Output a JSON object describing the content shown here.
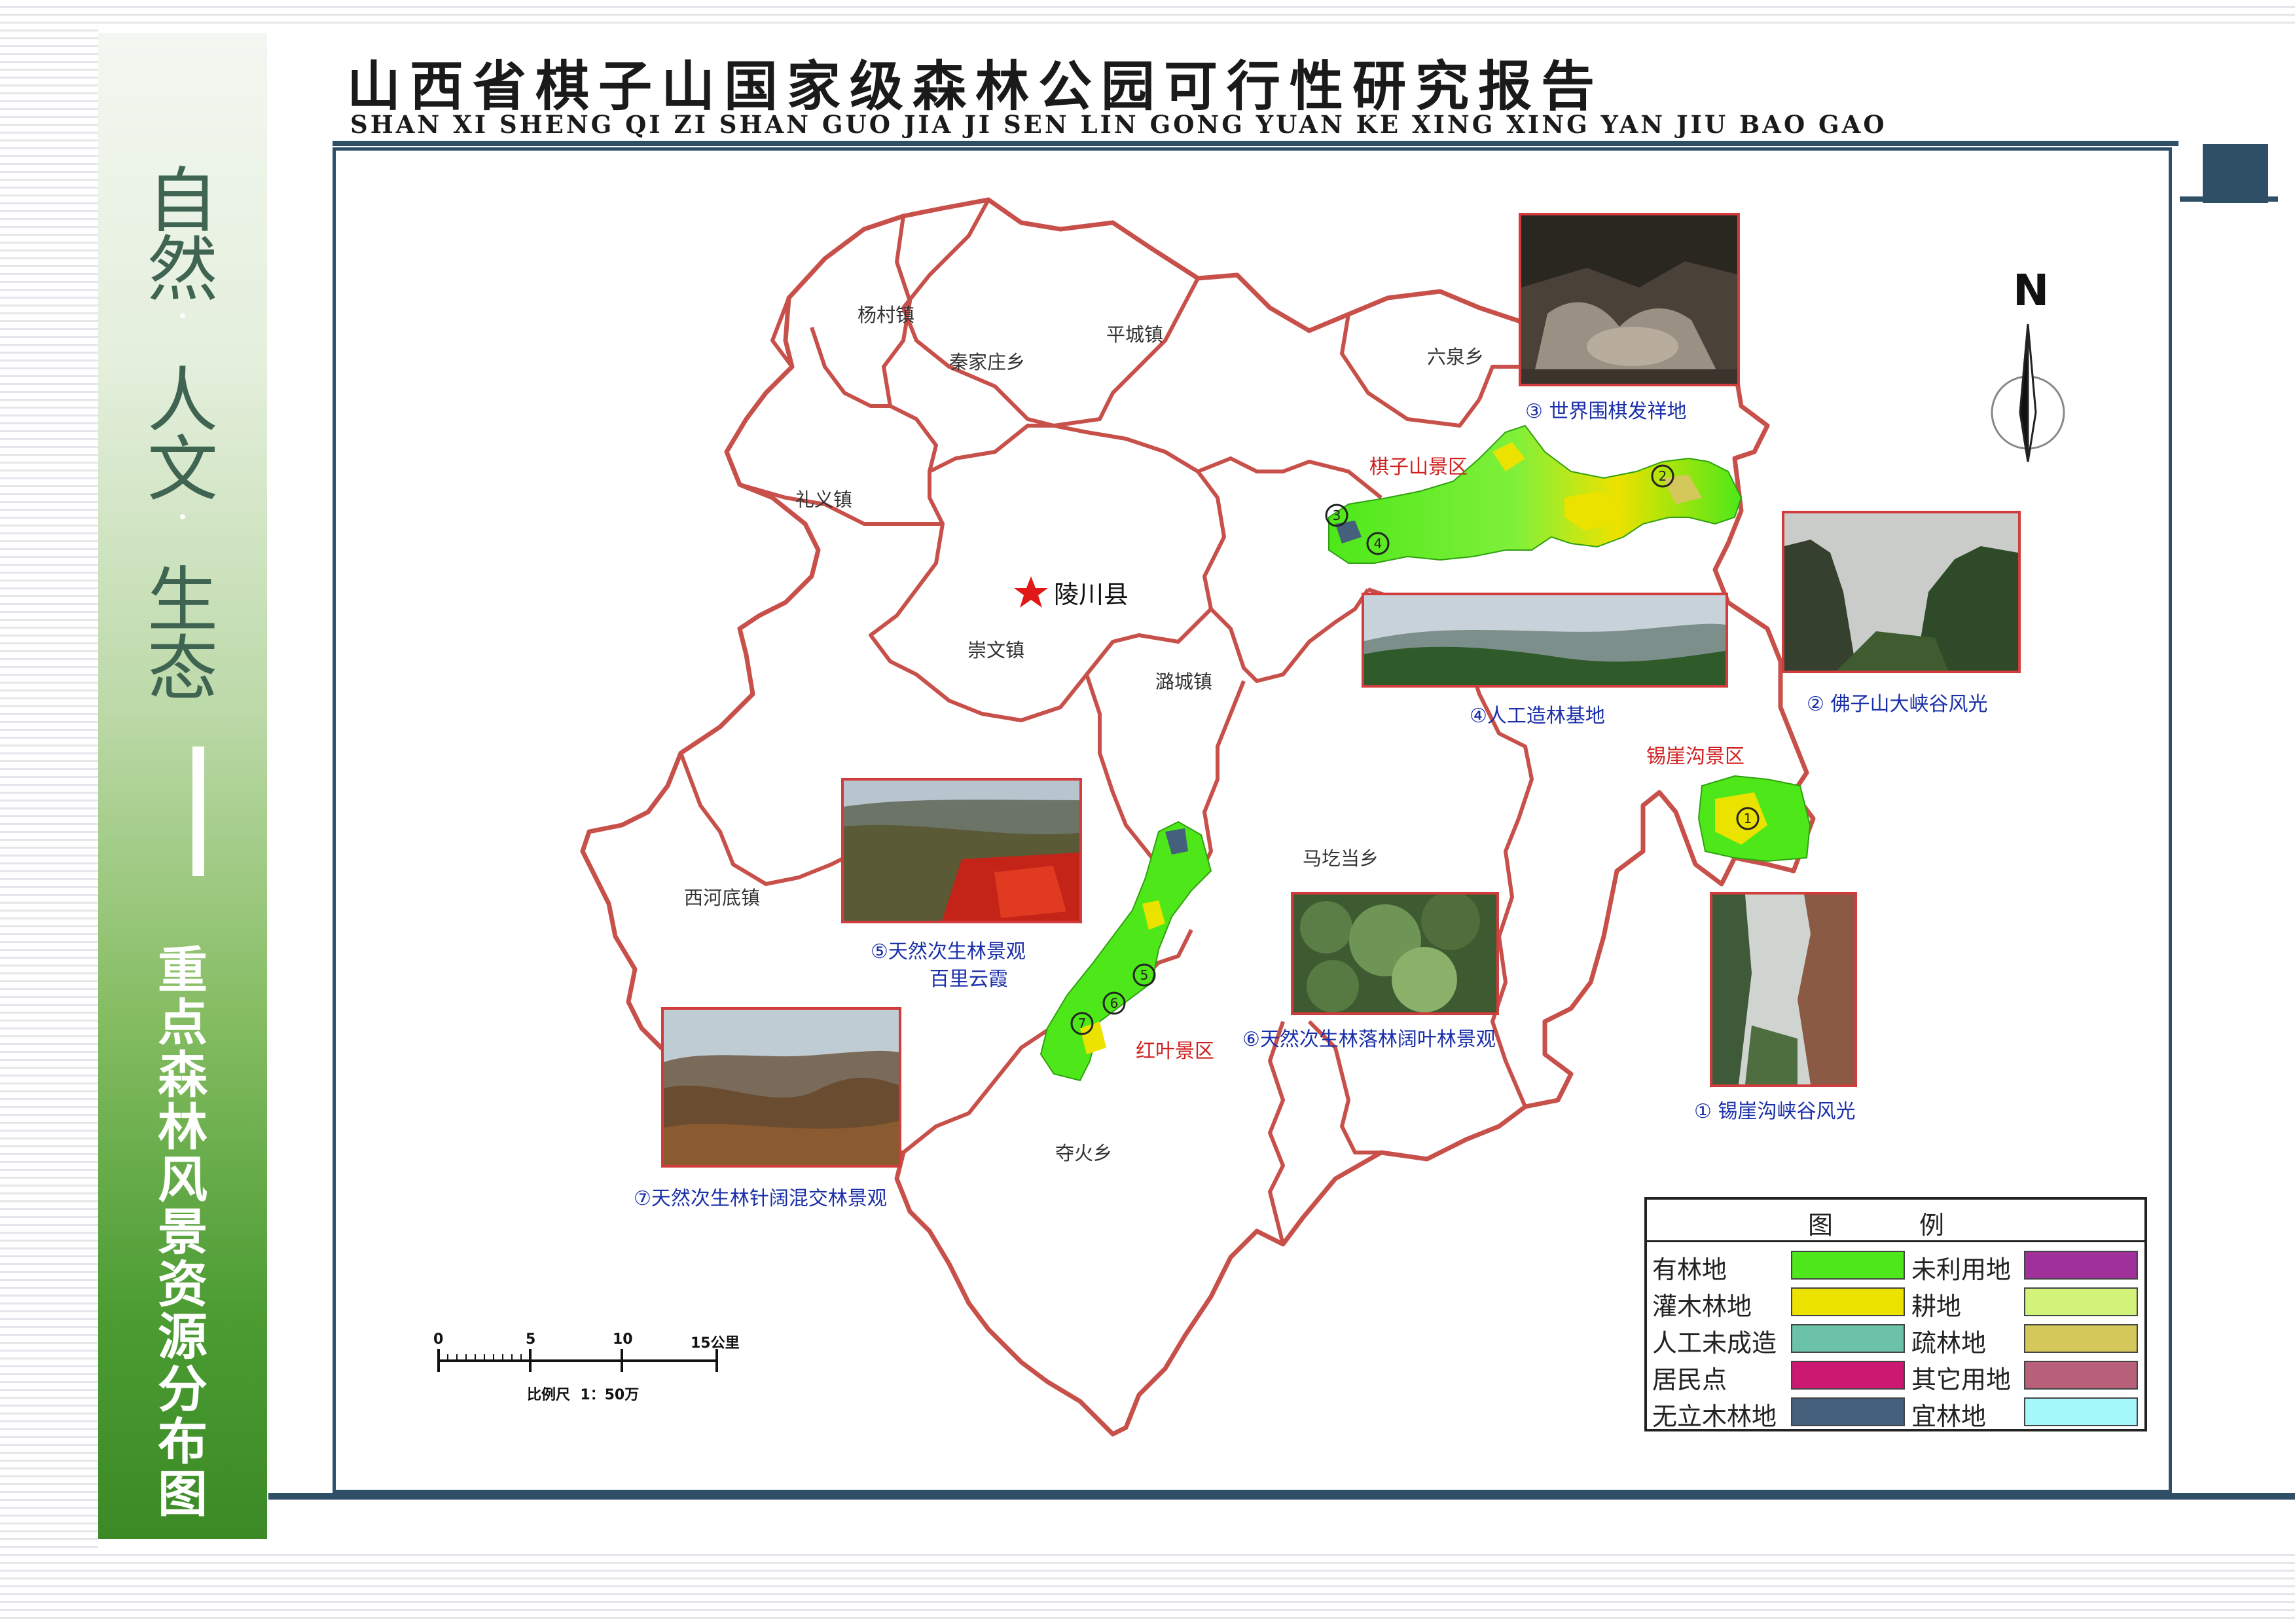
{
  "header": {
    "title": "山西省棋子山国家级森林公园可行性研究报告",
    "subtitle": "SHAN XI SHENG QI ZI SHAN GUO JIA JI SEN LIN GONG YUAN KE XING XING YAN JIU BAO GAO"
  },
  "sidebar": {
    "top_chars": [
      "自",
      "然",
      "人",
      "文",
      "生",
      "态"
    ],
    "dot": "·",
    "vertical_title": [
      "重",
      "点",
      "森",
      "林",
      "风",
      "景",
      "资",
      "源",
      "分",
      "布",
      "图"
    ]
  },
  "map": {
    "county_seat": "陵川县",
    "towns": [
      "杨村镇",
      "秦家庄乡",
      "平城镇",
      "六泉乡",
      "礼义镇",
      "崇文镇",
      "潞城镇",
      "马圪当乡",
      "西河底镇",
      "夺火乡"
    ],
    "scenic_areas": [
      "棋子山景区",
      "锡崖沟景区",
      "红叶景区"
    ],
    "north": "N",
    "scale": {
      "ticks": [
        "0",
        "5",
        "10",
        "15公里"
      ],
      "label": "比例尺  1：50万"
    }
  },
  "photos": [
    {
      "num": "①",
      "caption": "锡崖沟峡谷风光"
    },
    {
      "num": "②",
      "caption": "佛子山大峡谷风光"
    },
    {
      "num": "③",
      "caption": "世界围棋发祥地"
    },
    {
      "num": "④",
      "caption": "人工造林基地"
    },
    {
      "num": "⑤",
      "caption": "天然次生林景观",
      "caption2": "百里云霞"
    },
    {
      "num": "⑥",
      "caption": "天然次生林落林阔叶林景观"
    },
    {
      "num": "⑦",
      "caption": "天然次生林针阔混交林景观"
    }
  ],
  "legend": {
    "title": "图 例",
    "items": [
      {
        "label": "有林地",
        "color": "#4ee81a"
      },
      {
        "label": "未利用地",
        "color": "#a0309a"
      },
      {
        "label": "灌木林地",
        "color": "#ece200"
      },
      {
        "label": "耕地",
        "color": "#d2f27a"
      },
      {
        "label": "人工未成造",
        "color": "#6cc2a8"
      },
      {
        "label": "疏林地",
        "color": "#d4c85a"
      },
      {
        "label": "居民点",
        "color": "#cc1870"
      },
      {
        "label": "其它用地",
        "color": "#b8607a"
      },
      {
        "label": "无立木林地",
        "color": "#44607c"
      },
      {
        "label": "宜林地",
        "color": "#a4f8fa"
      }
    ]
  },
  "colors": {
    "boundary": "#c8504a",
    "frame": "#2f4f66",
    "caption": "#1a2fa8",
    "scenic_label": "#d02020",
    "star": "#e01818"
  }
}
